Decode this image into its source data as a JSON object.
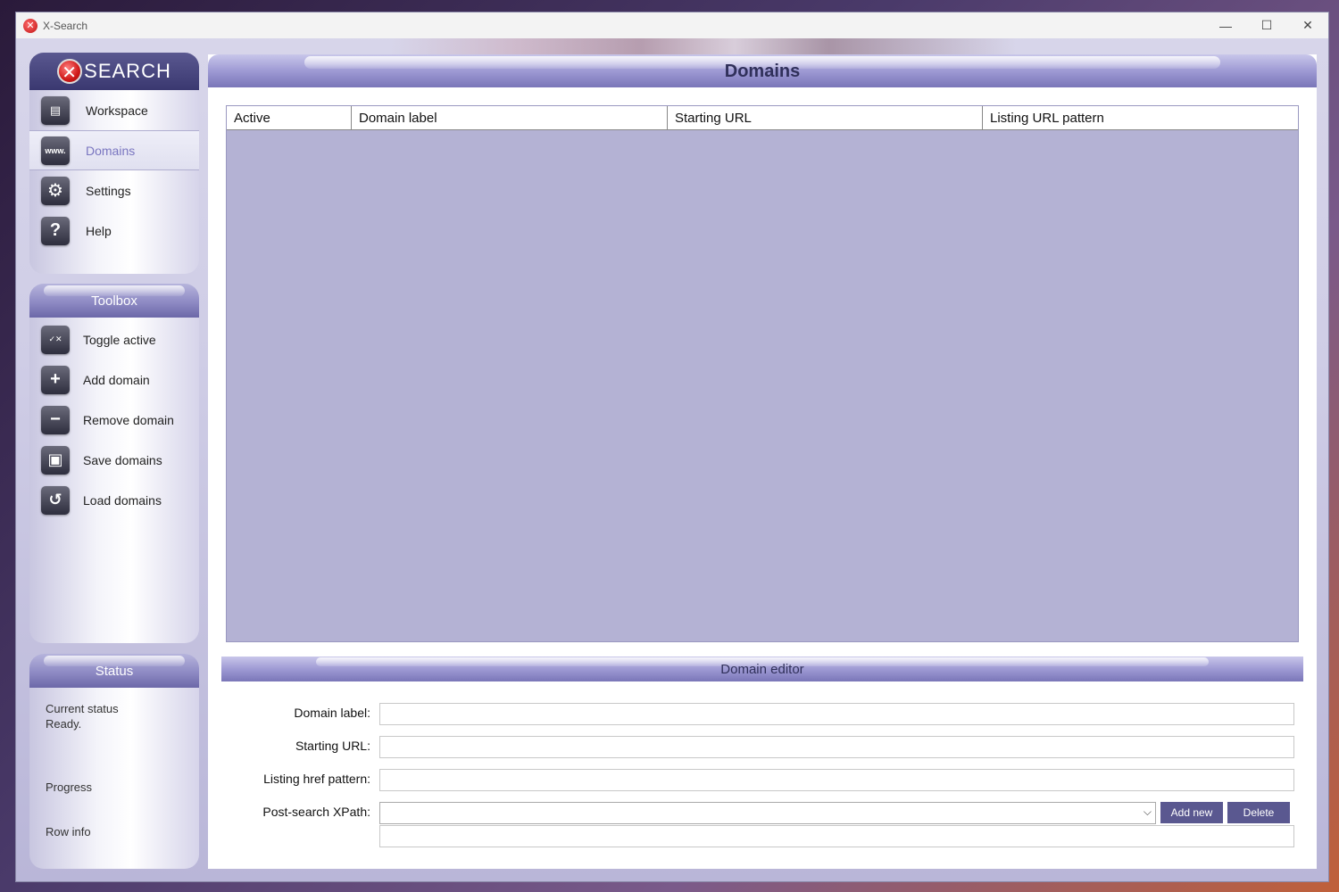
{
  "window": {
    "title": "X-Search",
    "controls": {
      "minimize": "—",
      "maximize": "☐",
      "close": "✕"
    }
  },
  "logo": {
    "x": "✕",
    "text": "SEARCH"
  },
  "nav": {
    "items": [
      {
        "label": "Workspace",
        "icon": "notepad-icon",
        "glyph": "▤"
      },
      {
        "label": "Domains",
        "icon": "www-icon",
        "glyph": "www."
      },
      {
        "label": "Settings",
        "icon": "gear-icon",
        "glyph": "⚙"
      },
      {
        "label": "Help",
        "icon": "question-icon",
        "glyph": "?"
      }
    ],
    "active": "Domains"
  },
  "toolbox": {
    "title": "Toolbox",
    "items": [
      {
        "label": "Toggle active",
        "icon": "toggle-www-icon",
        "glyph": "✓✕"
      },
      {
        "label": "Add domain",
        "icon": "add-www-icon",
        "glyph": "+"
      },
      {
        "label": "Remove domain",
        "icon": "remove-www-icon",
        "glyph": "−"
      },
      {
        "label": "Save domains",
        "icon": "save-icon",
        "glyph": "▣"
      },
      {
        "label": "Load domains",
        "icon": "load-icon",
        "glyph": "↺"
      }
    ]
  },
  "status": {
    "title": "Status",
    "current_status_label": "Current status",
    "current_status_value": "Ready.",
    "progress_label": "Progress",
    "row_info_label": "Row info"
  },
  "main": {
    "title": "Domains",
    "table": {
      "columns": [
        "Active",
        "Domain label",
        "Starting URL",
        "Listing URL pattern"
      ],
      "rows": []
    }
  },
  "editor": {
    "title": "Domain editor",
    "domain_label": {
      "label": "Domain label:",
      "value": ""
    },
    "starting_url": {
      "label": "Starting URL:",
      "value": ""
    },
    "listing_href_pattern": {
      "label": "Listing href pattern:",
      "value": ""
    },
    "post_search_xpath": {
      "label": "Post-search XPath:",
      "value": "",
      "chevron": "⌵"
    },
    "xpath_detail": {
      "value": ""
    },
    "add_new_label": "Add new",
    "delete_label": "Delete"
  }
}
